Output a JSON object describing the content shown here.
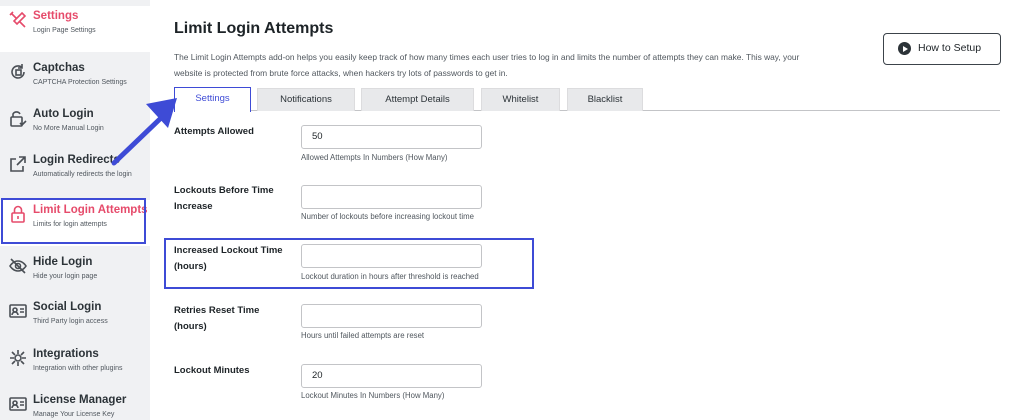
{
  "sidebar": {
    "items": [
      {
        "label": "Settings",
        "sub": "Login Page Settings",
        "icon": "tools-icon"
      },
      {
        "label": "Captchas",
        "sub": "CAPTCHA Protection Settings",
        "icon": "refresh-shield-icon"
      },
      {
        "label": "Auto Login",
        "sub": "No More Manual Login",
        "icon": "lock-check-icon"
      },
      {
        "label": "Login Redirects",
        "sub": "Automatically redirects the login",
        "icon": "external-link-icon"
      },
      {
        "label": "Limit Login Attempts",
        "sub": "Limits for login attempts",
        "icon": "padlock-icon"
      },
      {
        "label": "Hide Login",
        "sub": "Hide your login page",
        "icon": "eye-slash-icon"
      },
      {
        "label": "Social Login",
        "sub": "Third Party login access",
        "icon": "id-card-icon"
      },
      {
        "label": "Integrations",
        "sub": "Integration with other plugins",
        "icon": "integrations-icon"
      },
      {
        "label": "License Manager",
        "sub": "Manage Your License Key",
        "icon": "license-card-icon"
      }
    ]
  },
  "main": {
    "title": "Limit Login Attempts",
    "description": "The Limit Login Attempts add-on helps you easily keep track of how many times each user tries to log in and limits the number of attempts they can make. This way, your website is protected from brute force attacks, when hackers try lots of passwords to get in.",
    "setup_button": "How to Setup",
    "tabs": [
      "Settings",
      "Notifications",
      "Attempt Details",
      "Whitelist",
      "Blacklist"
    ],
    "fields": [
      {
        "label": "Attempts Allowed",
        "value": "50",
        "help": "Allowed Attempts In Numbers (How Many)"
      },
      {
        "label": "Lockouts Before Time Increase",
        "value": "",
        "help": "Number of lockouts before increasing lockout time"
      },
      {
        "label": "Increased Lockout Time (hours)",
        "value": "",
        "help": "Lockout duration in hours after threshold is reached"
      },
      {
        "label": "Retries Reset Time (hours)",
        "value": "",
        "help": "Hours until failed attempts are reset"
      },
      {
        "label": "Lockout Minutes",
        "value": "20",
        "help": "Lockout Minutes In Numbers (How Many)"
      }
    ]
  },
  "colors": {
    "accent": "#3e4bd6",
    "active_pink": "#e64b6b",
    "sidebar_bg": "#f0f1f3"
  }
}
